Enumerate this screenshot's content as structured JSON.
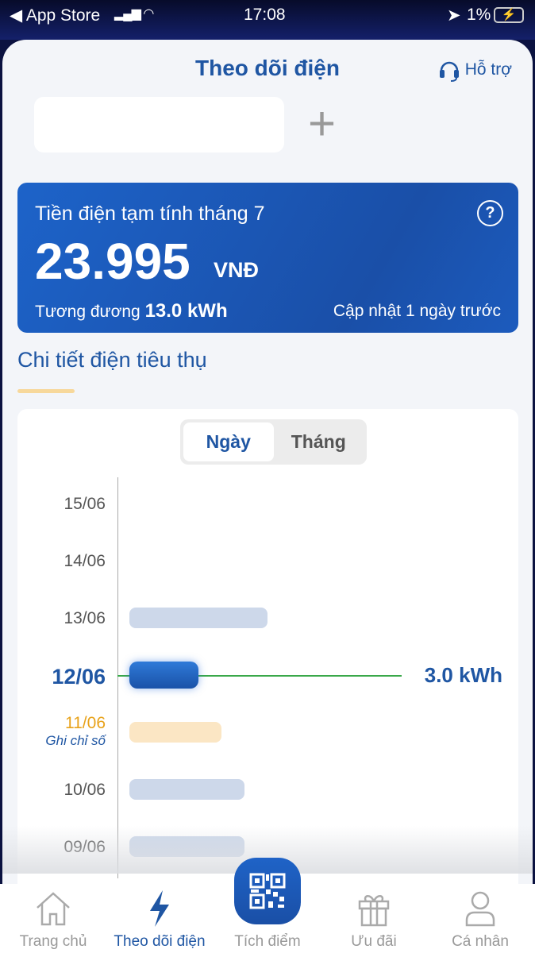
{
  "status": {
    "back": "◀ App Store",
    "time": "17:08",
    "battery": "1%"
  },
  "header": {
    "title": "Theo dõi điện",
    "support": "Hỗ trợ"
  },
  "card": {
    "label": "Tiền điện tạm tính tháng 7",
    "amount": "23.995",
    "currency": "VNĐ",
    "equiv_label": "Tương đương",
    "equiv_value": "13.0 kWh",
    "updated": "Cập nhật 1 ngày trước"
  },
  "section": {
    "title": "Chi tiết điện tiêu thụ"
  },
  "segment": {
    "day": "Ngày",
    "month": "Tháng"
  },
  "colors": {
    "accent": "#1f56a3",
    "bar": "#cdd8ea",
    "reading_bar": "#fbe6c4",
    "reading_text": "#e8a21a",
    "marker_line": "#3aa84a"
  },
  "chart_data": {
    "type": "bar",
    "orientation": "horizontal",
    "unit": "kWh",
    "categories": [
      "15/06",
      "14/06",
      "13/06",
      "12/06",
      "11/06",
      "10/06",
      "09/06"
    ],
    "values": [
      null,
      null,
      6.0,
      3.0,
      4.0,
      5.0,
      5.0
    ],
    "selected": "12/06",
    "selected_label": "3.0 kWh",
    "reading_day": "11/06",
    "reading_note": "Ghi chỉ số"
  },
  "tabs": [
    {
      "label": "Trang chủ",
      "icon": "home-icon"
    },
    {
      "label": "Theo dõi điện",
      "icon": "bolt-icon"
    },
    {
      "label": "Tích điểm",
      "icon": "qr-code-icon"
    },
    {
      "label": "Ưu đãi",
      "icon": "gift-icon"
    },
    {
      "label": "Cá nhân",
      "icon": "user-icon"
    }
  ]
}
